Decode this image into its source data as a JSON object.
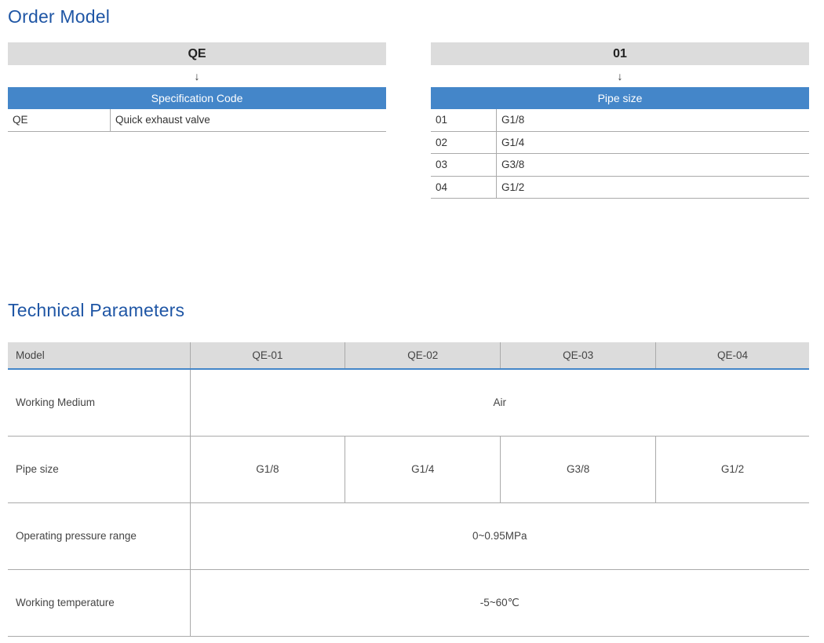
{
  "order_model": {
    "title": "Order Model",
    "left": {
      "code": "QE",
      "arrow": "↓",
      "section": "Specification Code",
      "options": [
        {
          "code": "QE",
          "desc": "Quick exhaust valve"
        }
      ]
    },
    "right": {
      "code": "01",
      "arrow": "↓",
      "section": "Pipe size",
      "options": [
        {
          "code": "01",
          "desc": "G1/8"
        },
        {
          "code": "02",
          "desc": "G1/4"
        },
        {
          "code": "03",
          "desc": "G3/8"
        },
        {
          "code": "04",
          "desc": "G1/2"
        }
      ]
    }
  },
  "technical_parameters": {
    "title": "Technical Parameters",
    "headers": [
      "Model",
      "QE-01",
      "QE-02",
      "QE-03",
      "QE-04"
    ],
    "rows": {
      "medium": {
        "label": "Working Medium",
        "value": "Air"
      },
      "pipe": {
        "label": "Pipe size",
        "values": [
          "G1/8",
          "G1/4",
          "G3/8",
          "G1/2"
        ]
      },
      "pressure": {
        "label": "Operating pressure range",
        "value": "0~0.95MPa"
      },
      "temperature": {
        "label": "Working temperature",
        "value": "-5~60℃"
      }
    }
  },
  "colors": {
    "title": "#1f56a5",
    "accent_bar": "#4486c9",
    "grey_bar": "#dcdcdc"
  }
}
